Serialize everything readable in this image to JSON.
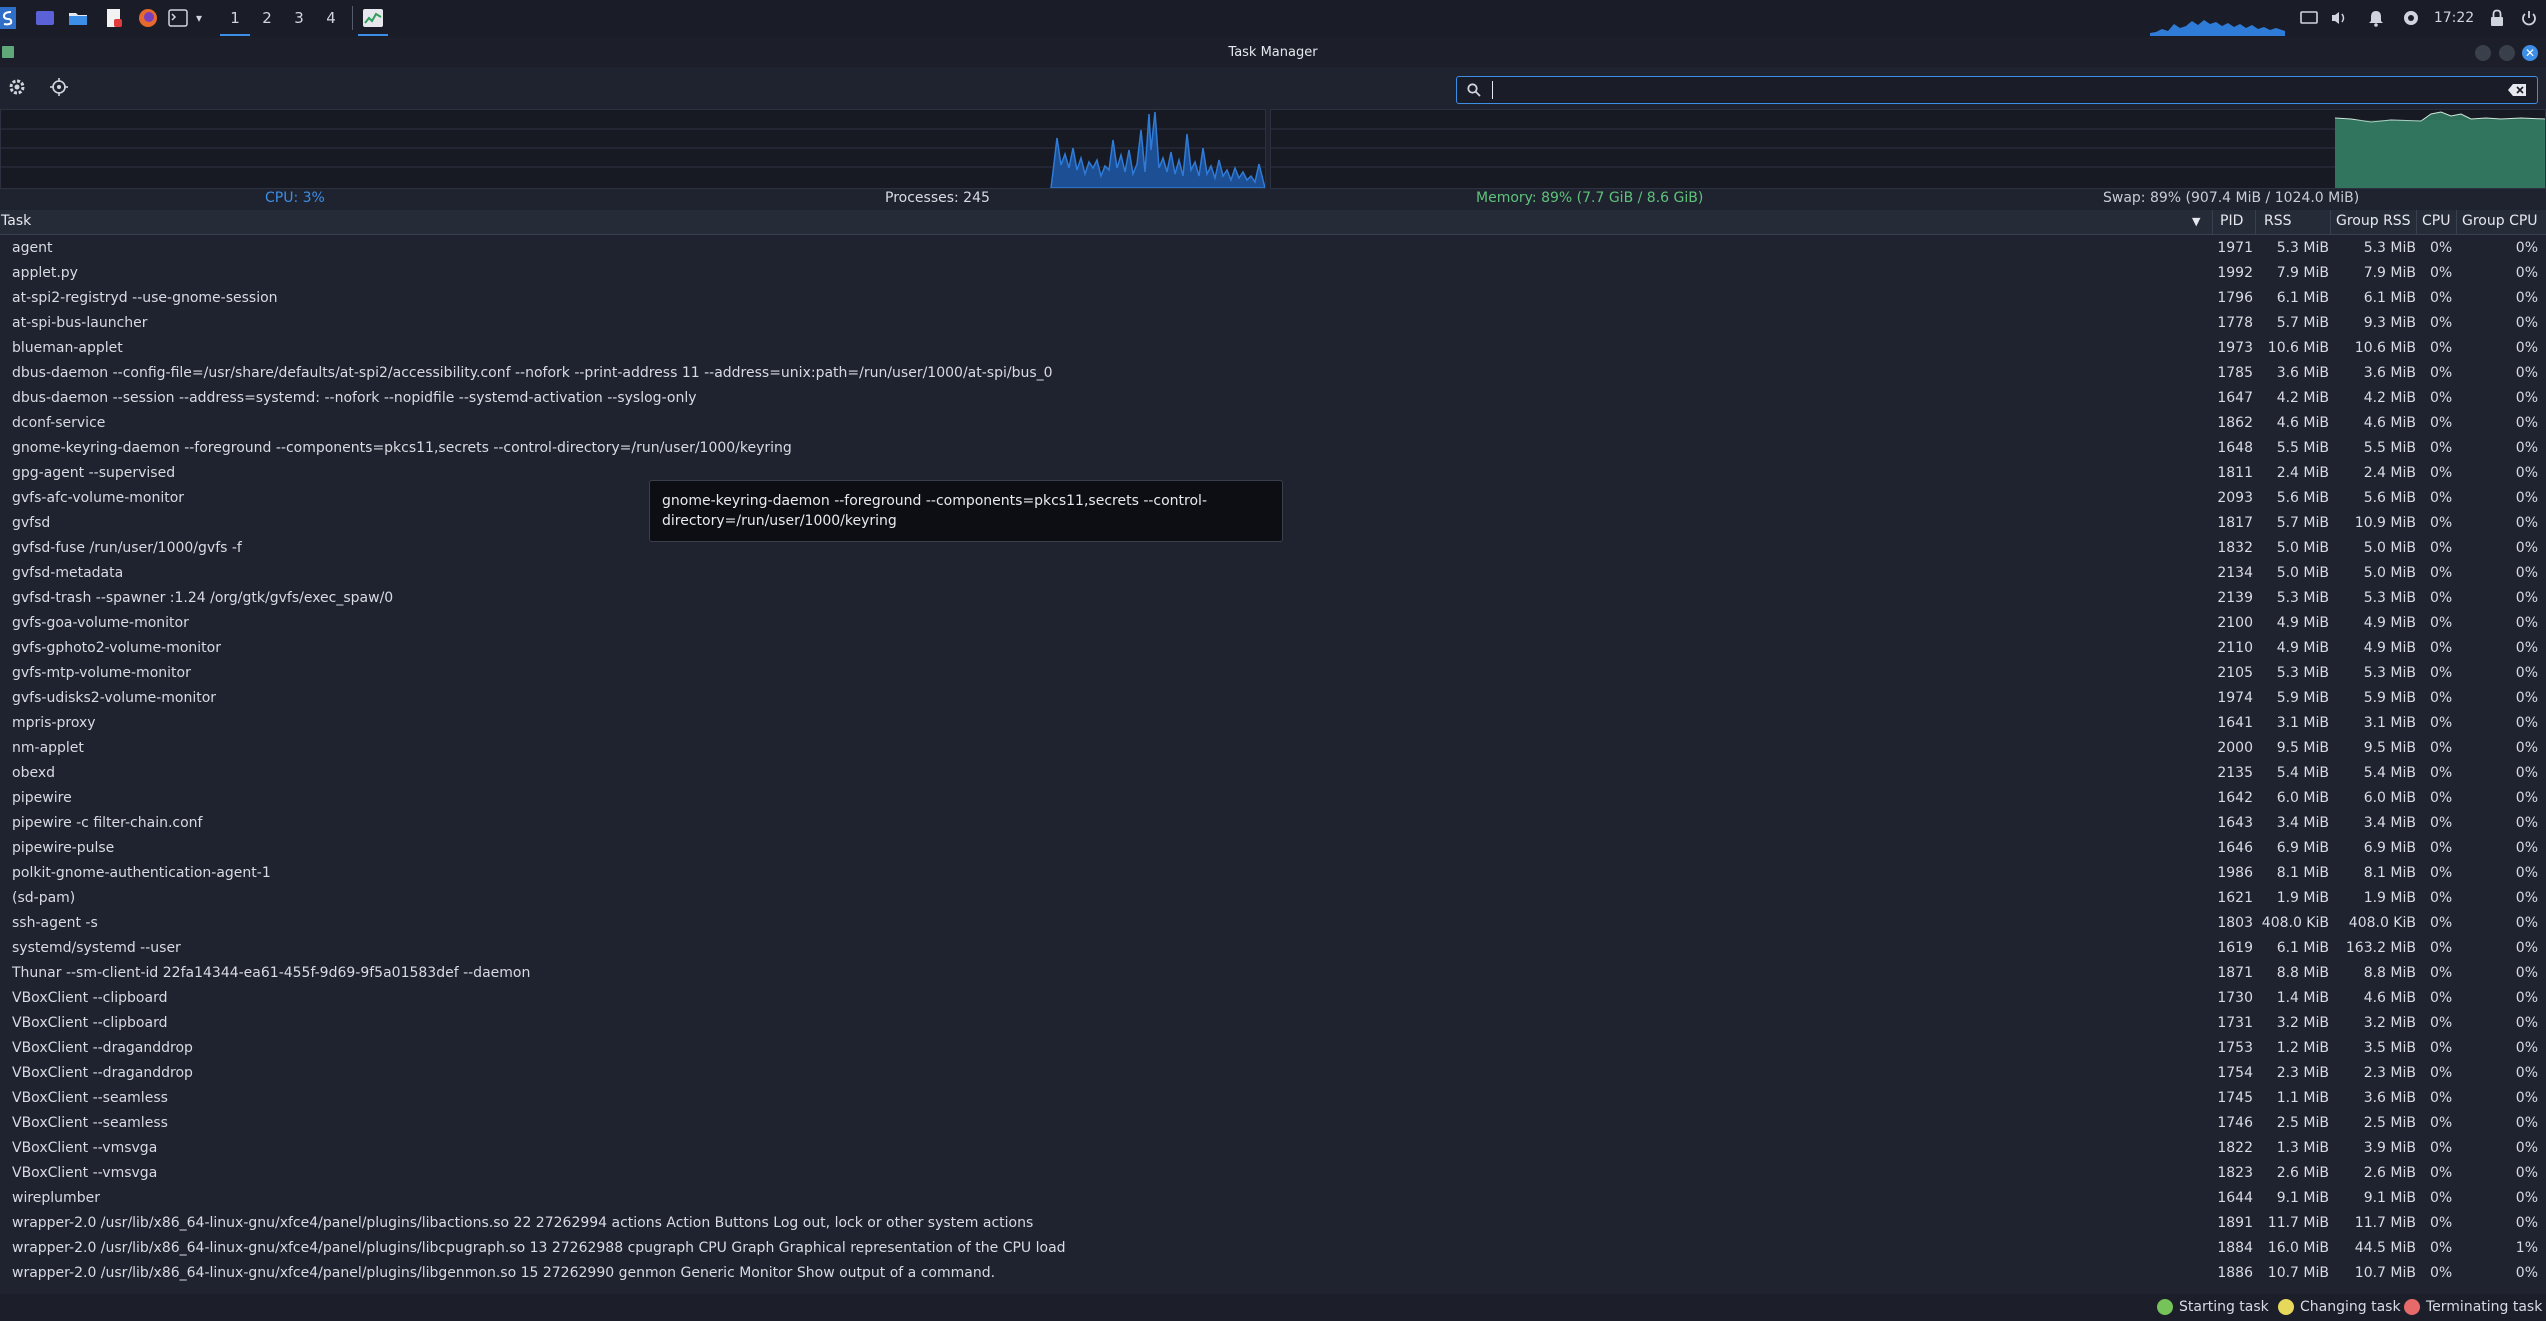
{
  "panel": {
    "workspaces": [
      "1",
      "2",
      "3",
      "4"
    ],
    "active_workspace": 0,
    "clock": "17:22",
    "launchers": [
      "app-menu-icon",
      "desktop-icon",
      "file-manager-icon",
      "text-editor-icon",
      "firefox-icon",
      "terminal-icon",
      "task-manager-icon"
    ],
    "tray_icons": [
      "display-icon",
      "volume-icon",
      "notification-icon",
      "network-icon",
      "lock-icon",
      "power-icon"
    ]
  },
  "window": {
    "title": "Task Manager"
  },
  "toolbar": {
    "search_value": "",
    "settings_icon": "gear-icon",
    "identify_icon": "crosshair-icon"
  },
  "stats": {
    "cpu": "CPU: 3%",
    "processes": "Processes: 245",
    "memory": "Memory: 89% (7.7 GiB / 8.6 GiB)",
    "swap": "Swap: 89% (907.4 MiB / 1024.0 MiB)"
  },
  "colors": {
    "cpu_graph": "#2f7bd8",
    "memory_graph": "#2e6e58",
    "cpu_text": "#3d8ee6",
    "memory_text": "#5fc27a",
    "accent": "#3d8ee6",
    "starting": "#76c35a",
    "changing": "#e6d85a",
    "terminating": "#e66a6a"
  },
  "table": {
    "headers": {
      "task": "Task",
      "pid": "PID",
      "rss": "RSS",
      "group_rss": "Group RSS",
      "cpu": "CPU",
      "group_cpu": "Group CPU"
    },
    "rows": [
      {
        "task": "agent",
        "pid": "1971",
        "rss": "5.3 MiB",
        "grss": "5.3 MiB",
        "cpu": "0%",
        "gcpu": "0%"
      },
      {
        "task": "applet.py",
        "pid": "1992",
        "rss": "7.9 MiB",
        "grss": "7.9 MiB",
        "cpu": "0%",
        "gcpu": "0%"
      },
      {
        "task": "at-spi2-registryd --use-gnome-session",
        "pid": "1796",
        "rss": "6.1 MiB",
        "grss": "6.1 MiB",
        "cpu": "0%",
        "gcpu": "0%"
      },
      {
        "task": "at-spi-bus-launcher",
        "pid": "1778",
        "rss": "5.7 MiB",
        "grss": "9.3 MiB",
        "cpu": "0%",
        "gcpu": "0%"
      },
      {
        "task": "blueman-applet",
        "pid": "1973",
        "rss": "10.6 MiB",
        "grss": "10.6 MiB",
        "cpu": "0%",
        "gcpu": "0%"
      },
      {
        "task": "dbus-daemon --config-file=/usr/share/defaults/at-spi2/accessibility.conf --nofork --print-address 11 --address=unix:path=/run/user/1000/at-spi/bus_0",
        "pid": "1785",
        "rss": "3.6 MiB",
        "grss": "3.6 MiB",
        "cpu": "0%",
        "gcpu": "0%"
      },
      {
        "task": "dbus-daemon --session --address=systemd: --nofork --nopidfile --systemd-activation --syslog-only",
        "pid": "1647",
        "rss": "4.2 MiB",
        "grss": "4.2 MiB",
        "cpu": "0%",
        "gcpu": "0%"
      },
      {
        "task": "dconf-service",
        "pid": "1862",
        "rss": "4.6 MiB",
        "grss": "4.6 MiB",
        "cpu": "0%",
        "gcpu": "0%"
      },
      {
        "task": "gnome-keyring-daemon --foreground --components=pkcs11,secrets --control-directory=/run/user/1000/keyring",
        "pid": "1648",
        "rss": "5.5 MiB",
        "grss": "5.5 MiB",
        "cpu": "0%",
        "gcpu": "0%"
      },
      {
        "task": "gpg-agent --supervised",
        "pid": "1811",
        "rss": "2.4 MiB",
        "grss": "2.4 MiB",
        "cpu": "0%",
        "gcpu": "0%"
      },
      {
        "task": "gvfs-afc-volume-monitor",
        "pid": "2093",
        "rss": "5.6 MiB",
        "grss": "5.6 MiB",
        "cpu": "0%",
        "gcpu": "0%"
      },
      {
        "task": "gvfsd",
        "pid": "1817",
        "rss": "5.7 MiB",
        "grss": "10.9 MiB",
        "cpu": "0%",
        "gcpu": "0%"
      },
      {
        "task": "gvfsd-fuse /run/user/1000/gvfs -f",
        "pid": "1832",
        "rss": "5.0 MiB",
        "grss": "5.0 MiB",
        "cpu": "0%",
        "gcpu": "0%"
      },
      {
        "task": "gvfsd-metadata",
        "pid": "2134",
        "rss": "5.0 MiB",
        "grss": "5.0 MiB",
        "cpu": "0%",
        "gcpu": "0%"
      },
      {
        "task": "gvfsd-trash --spawner :1.24 /org/gtk/gvfs/exec_spaw/0",
        "pid": "2139",
        "rss": "5.3 MiB",
        "grss": "5.3 MiB",
        "cpu": "0%",
        "gcpu": "0%"
      },
      {
        "task": "gvfs-goa-volume-monitor",
        "pid": "2100",
        "rss": "4.9 MiB",
        "grss": "4.9 MiB",
        "cpu": "0%",
        "gcpu": "0%"
      },
      {
        "task": "gvfs-gphoto2-volume-monitor",
        "pid": "2110",
        "rss": "4.9 MiB",
        "grss": "4.9 MiB",
        "cpu": "0%",
        "gcpu": "0%"
      },
      {
        "task": "gvfs-mtp-volume-monitor",
        "pid": "2105",
        "rss": "5.3 MiB",
        "grss": "5.3 MiB",
        "cpu": "0%",
        "gcpu": "0%"
      },
      {
        "task": "gvfs-udisks2-volume-monitor",
        "pid": "1974",
        "rss": "5.9 MiB",
        "grss": "5.9 MiB",
        "cpu": "0%",
        "gcpu": "0%"
      },
      {
        "task": "mpris-proxy",
        "pid": "1641",
        "rss": "3.1 MiB",
        "grss": "3.1 MiB",
        "cpu": "0%",
        "gcpu": "0%"
      },
      {
        "task": "nm-applet",
        "pid": "2000",
        "rss": "9.5 MiB",
        "grss": "9.5 MiB",
        "cpu": "0%",
        "gcpu": "0%"
      },
      {
        "task": "obexd",
        "pid": "2135",
        "rss": "5.4 MiB",
        "grss": "5.4 MiB",
        "cpu": "0%",
        "gcpu": "0%"
      },
      {
        "task": "pipewire",
        "pid": "1642",
        "rss": "6.0 MiB",
        "grss": "6.0 MiB",
        "cpu": "0%",
        "gcpu": "0%"
      },
      {
        "task": "pipewire -c filter-chain.conf",
        "pid": "1643",
        "rss": "3.4 MiB",
        "grss": "3.4 MiB",
        "cpu": "0%",
        "gcpu": "0%"
      },
      {
        "task": "pipewire-pulse",
        "pid": "1646",
        "rss": "6.9 MiB",
        "grss": "6.9 MiB",
        "cpu": "0%",
        "gcpu": "0%"
      },
      {
        "task": "polkit-gnome-authentication-agent-1",
        "pid": "1986",
        "rss": "8.1 MiB",
        "grss": "8.1 MiB",
        "cpu": "0%",
        "gcpu": "0%"
      },
      {
        "task": "(sd-pam)",
        "pid": "1621",
        "rss": "1.9 MiB",
        "grss": "1.9 MiB",
        "cpu": "0%",
        "gcpu": "0%"
      },
      {
        "task": "ssh-agent -s",
        "pid": "1803",
        "rss": "408.0 KiB",
        "grss": "408.0 KiB",
        "cpu": "0%",
        "gcpu": "0%"
      },
      {
        "task": "systemd/systemd --user",
        "pid": "1619",
        "rss": "6.1 MiB",
        "grss": "163.2 MiB",
        "cpu": "0%",
        "gcpu": "0%"
      },
      {
        "task": "Thunar --sm-client-id 22fa14344-ea61-455f-9d69-9f5a01583def --daemon",
        "pid": "1871",
        "rss": "8.8 MiB",
        "grss": "8.8 MiB",
        "cpu": "0%",
        "gcpu": "0%"
      },
      {
        "task": "VBoxClient --clipboard",
        "pid": "1730",
        "rss": "1.4 MiB",
        "grss": "4.6 MiB",
        "cpu": "0%",
        "gcpu": "0%"
      },
      {
        "task": "VBoxClient --clipboard",
        "pid": "1731",
        "rss": "3.2 MiB",
        "grss": "3.2 MiB",
        "cpu": "0%",
        "gcpu": "0%"
      },
      {
        "task": "VBoxClient --draganddrop",
        "pid": "1753",
        "rss": "1.2 MiB",
        "grss": "3.5 MiB",
        "cpu": "0%",
        "gcpu": "0%"
      },
      {
        "task": "VBoxClient --draganddrop",
        "pid": "1754",
        "rss": "2.3 MiB",
        "grss": "2.3 MiB",
        "cpu": "0%",
        "gcpu": "0%"
      },
      {
        "task": "VBoxClient --seamless",
        "pid": "1745",
        "rss": "1.1 MiB",
        "grss": "3.6 MiB",
        "cpu": "0%",
        "gcpu": "0%"
      },
      {
        "task": "VBoxClient --seamless",
        "pid": "1746",
        "rss": "2.5 MiB",
        "grss": "2.5 MiB",
        "cpu": "0%",
        "gcpu": "0%"
      },
      {
        "task": "VBoxClient --vmsvga",
        "pid": "1822",
        "rss": "1.3 MiB",
        "grss": "3.9 MiB",
        "cpu": "0%",
        "gcpu": "0%"
      },
      {
        "task": "VBoxClient --vmsvga",
        "pid": "1823",
        "rss": "2.6 MiB",
        "grss": "2.6 MiB",
        "cpu": "0%",
        "gcpu": "0%"
      },
      {
        "task": "wireplumber",
        "pid": "1644",
        "rss": "9.1 MiB",
        "grss": "9.1 MiB",
        "cpu": "0%",
        "gcpu": "0%"
      },
      {
        "task": "wrapper-2.0 /usr/lib/x86_64-linux-gnu/xfce4/panel/plugins/libactions.so 22 27262994 actions Action Buttons Log out, lock or other system actions",
        "pid": "1891",
        "rss": "11.7 MiB",
        "grss": "11.7 MiB",
        "cpu": "0%",
        "gcpu": "0%"
      },
      {
        "task": "wrapper-2.0 /usr/lib/x86_64-linux-gnu/xfce4/panel/plugins/libcpugraph.so 13 27262988 cpugraph CPU Graph Graphical representation of the CPU load",
        "pid": "1884",
        "rss": "16.0 MiB",
        "grss": "44.5 MiB",
        "cpu": "0%",
        "gcpu": "1%"
      },
      {
        "task": "wrapper-2.0 /usr/lib/x86_64-linux-gnu/xfce4/panel/plugins/libgenmon.so 15 27262990 genmon Generic Monitor Show output of a command.",
        "pid": "1886",
        "rss": "10.7 MiB",
        "grss": "10.7 MiB",
        "cpu": "0%",
        "gcpu": "0%"
      }
    ]
  },
  "tooltip": {
    "text": "gnome-keyring-daemon --foreground --components=pkcs11,secrets --control-directory=/run/user/1000/keyring"
  },
  "legend": {
    "starting": "Starting task",
    "changing": "Changing task",
    "terminating": "Terminating task"
  }
}
